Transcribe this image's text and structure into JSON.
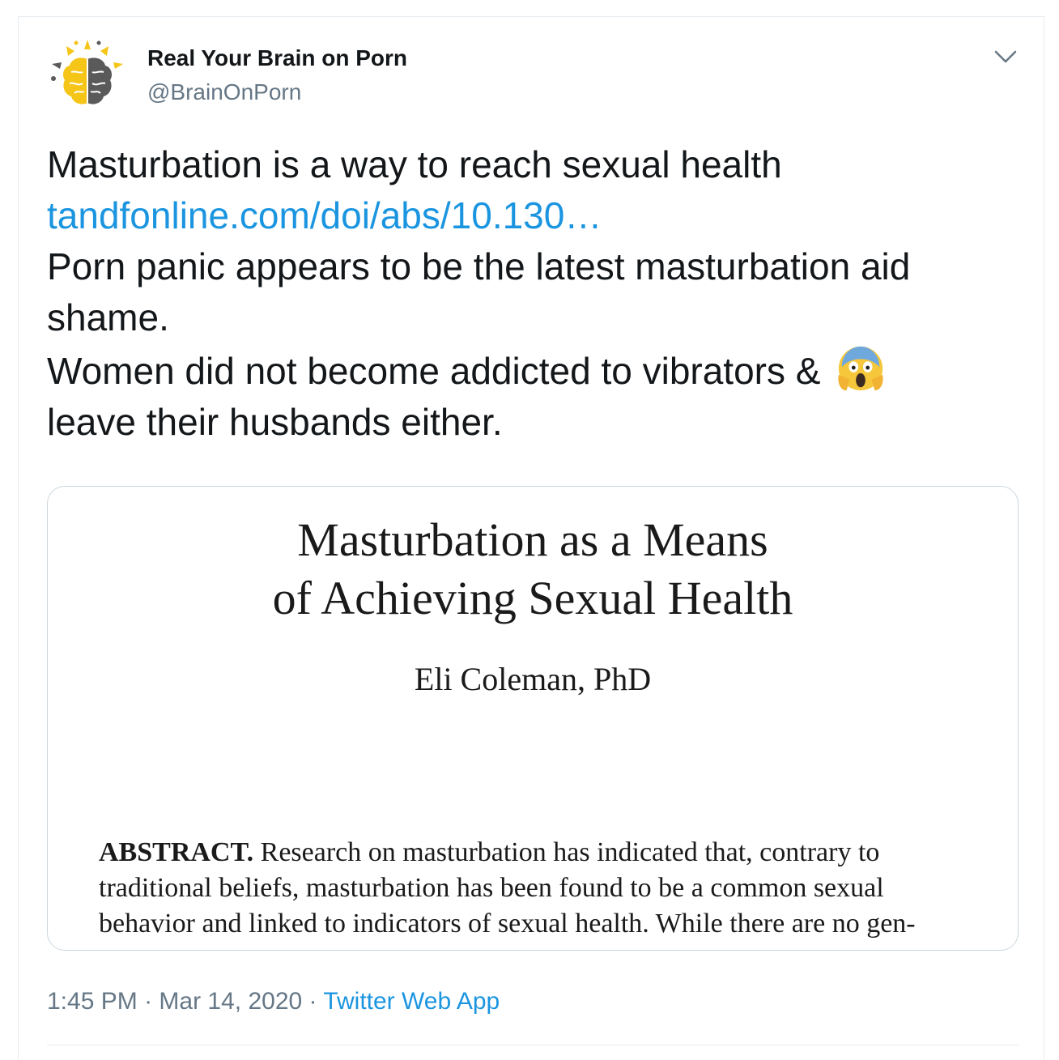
{
  "tweet": {
    "author": {
      "display_name": "Real Your Brain on Porn",
      "handle": "@BrainOnPorn",
      "avatar_icon": "brain-sun-logo-icon"
    },
    "menu_icon": "chevron-down-icon",
    "text_lines": [
      "Masturbation is a way to reach sexual health",
      "tandfonline.com/doi/abs/10.130…",
      "Porn panic appears to be the latest masturbation aid",
      "shame.",
      "Women did not become addicted to vibrators & ",
      " leave their husbands either."
    ],
    "emoji_icon": "face-screaming-in-fear-icon",
    "media": {
      "title_line1": "Masturbation as a Means",
      "title_line2": "of Achieving Sexual Health",
      "author": "Eli Coleman, PhD",
      "abstract_label": "ABSTRACT.",
      "abstract_line1": " Research on masturbation has indicated that, contrary to",
      "abstract_line2": "traditional beliefs, masturbation has been found to be a common sexual",
      "abstract_line3": "behavior and linked to indicators of sexual health. While there are no gen-"
    },
    "meta": {
      "time": "1:45 PM",
      "separator1": " · ",
      "date": "Mar 14, 2020",
      "separator2": " · ",
      "source": "Twitter Web App"
    },
    "colors": {
      "link": "#1b95e0",
      "secondary_text": "#657786",
      "border": "#e6ecf0",
      "logo_yellow": "#f5c518",
      "logo_gray": "#5a5a5a"
    }
  }
}
